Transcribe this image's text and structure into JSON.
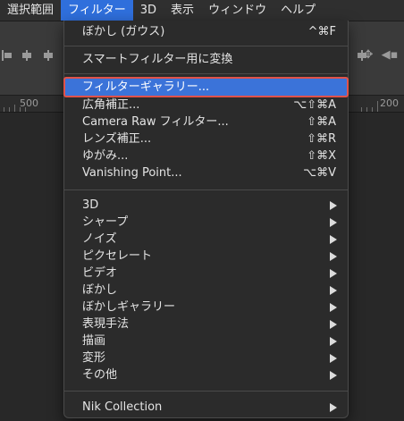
{
  "menubar": {
    "items": [
      {
        "label": "選択範囲",
        "active": false
      },
      {
        "label": "フィルター",
        "active": true
      },
      {
        "label": "3D",
        "active": false
      },
      {
        "label": "表示",
        "active": false
      },
      {
        "label": "ウィンドウ",
        "active": false
      },
      {
        "label": "ヘルプ",
        "active": false
      }
    ]
  },
  "ruler": {
    "labels": [
      "500",
      "200"
    ]
  },
  "colors": {
    "menubar_active": "#2f6fdc",
    "highlight": "#3b73d9",
    "highlight_border": "#e0524a",
    "menu_bg": "#2b2b2b"
  },
  "filter_menu": {
    "last_filter": {
      "label": "ぼかし (ガウス)",
      "shortcut": "^⌘F"
    },
    "convert_smart": {
      "label": "スマートフィルター用に変換"
    },
    "gallery": {
      "label": "フィルターギャラリー..."
    },
    "primary": [
      {
        "label": "広角補正...",
        "shortcut": "⌥⇧⌘A"
      },
      {
        "label": "Camera Raw フィルター...",
        "shortcut": "⇧⌘A"
      },
      {
        "label": "レンズ補正...",
        "shortcut": "⇧⌘R"
      },
      {
        "label": "ゆがみ...",
        "shortcut": "⇧⌘X"
      },
      {
        "label": "Vanishing Point...",
        "shortcut": "⌥⌘V"
      }
    ],
    "submenus": [
      {
        "label": "3D"
      },
      {
        "label": "シャープ"
      },
      {
        "label": "ノイズ"
      },
      {
        "label": "ピクセレート"
      },
      {
        "label": "ビデオ"
      },
      {
        "label": "ぼかし"
      },
      {
        "label": "ぼかしギャラリー"
      },
      {
        "label": "表現手法"
      },
      {
        "label": "描画"
      },
      {
        "label": "変形"
      },
      {
        "label": "その他"
      }
    ],
    "plugins": [
      {
        "label": "Nik Collection"
      }
    ]
  }
}
